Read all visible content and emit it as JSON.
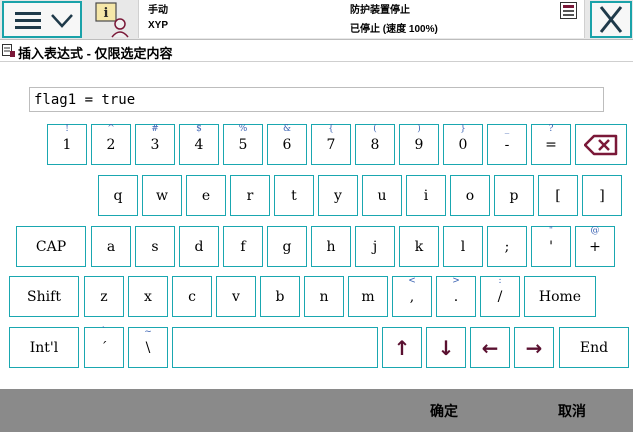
{
  "status": {
    "mode": "手动",
    "controller": "XYP",
    "guard_state": "防护装置停止",
    "run_state": "已停止 (速度 100%)"
  },
  "dialog": {
    "title": "插入表达式 - 仅限选定内容"
  },
  "expression": {
    "value": "flag1 = true"
  },
  "keyboard": {
    "row1": [
      {
        "main": "1",
        "sup": "!"
      },
      {
        "main": "2",
        "sup": "^"
      },
      {
        "main": "3",
        "sup": "#"
      },
      {
        "main": "4",
        "sup": "$"
      },
      {
        "main": "5",
        "sup": "%"
      },
      {
        "main": "6",
        "sup": "&"
      },
      {
        "main": "7",
        "sup": "{"
      },
      {
        "main": "8",
        "sup": "("
      },
      {
        "main": "9",
        "sup": ")"
      },
      {
        "main": "0",
        "sup": "}"
      },
      {
        "main": "-",
        "sup": "_"
      },
      {
        "main": "=",
        "sup": "?"
      }
    ],
    "row2": [
      {
        "main": "q"
      },
      {
        "main": "w"
      },
      {
        "main": "e"
      },
      {
        "main": "r"
      },
      {
        "main": "t"
      },
      {
        "main": "y"
      },
      {
        "main": "u"
      },
      {
        "main": "i"
      },
      {
        "main": "o"
      },
      {
        "main": "p"
      },
      {
        "main": "["
      },
      {
        "main": "]"
      }
    ],
    "row3": [
      {
        "main": "CAP"
      },
      {
        "main": "a"
      },
      {
        "main": "s"
      },
      {
        "main": "d"
      },
      {
        "main": "f"
      },
      {
        "main": "g"
      },
      {
        "main": "h"
      },
      {
        "main": "j"
      },
      {
        "main": "k"
      },
      {
        "main": "l"
      },
      {
        "main": ";",
        "sup": ""
      },
      {
        "main": "'",
        "sup": "\""
      },
      {
        "main": "+",
        "sup": "@"
      }
    ],
    "row4": [
      {
        "main": "Shift"
      },
      {
        "main": "z"
      },
      {
        "main": "x"
      },
      {
        "main": "c"
      },
      {
        "main": "v"
      },
      {
        "main": "b"
      },
      {
        "main": "n"
      },
      {
        "main": "m"
      },
      {
        "main": ",",
        "sup": "<"
      },
      {
        "main": ".",
        "sup": ">"
      },
      {
        "main": "/",
        "sup": ":"
      },
      {
        "main": "Home"
      }
    ],
    "row5": [
      {
        "main": "Int'l"
      },
      {
        "main": "´",
        "sup": "`"
      },
      {
        "main": "\\",
        "sup": "~"
      },
      {
        "main": ""
      },
      {
        "main": "↑"
      },
      {
        "main": "↓"
      },
      {
        "main": "←"
      },
      {
        "main": "→"
      },
      {
        "main": "End"
      }
    ]
  },
  "footer": {
    "ok_label": "确定",
    "cancel_label": "取消"
  },
  "colors": {
    "key_border": "#1aa7b0",
    "arrow": "#5a1030",
    "backspace": "#7a1838",
    "footer_bg": "#8a8a8a"
  },
  "icons": [
    "menu-icon",
    "chevron-down-icon",
    "abb-info-icon",
    "window-icon",
    "close-icon",
    "expression-icon",
    "backspace-icon"
  ]
}
